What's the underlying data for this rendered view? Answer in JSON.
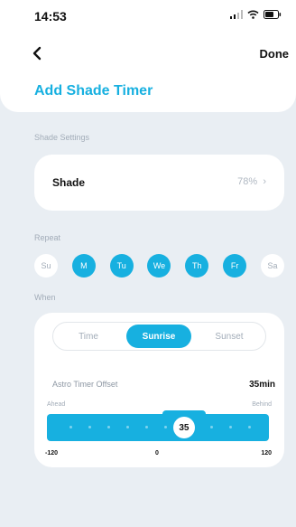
{
  "status": {
    "time": "14:53"
  },
  "nav": {
    "done_label": "Done"
  },
  "page": {
    "title": "Add Shade Timer"
  },
  "shade_settings": {
    "section_label": "Shade Settings",
    "shade_label": "Shade",
    "shade_value": "78%"
  },
  "repeat": {
    "section_label": "Repeat",
    "days": [
      {
        "label": "Su",
        "selected": false
      },
      {
        "label": "M",
        "selected": true
      },
      {
        "label": "Tu",
        "selected": true
      },
      {
        "label": "We",
        "selected": true
      },
      {
        "label": "Th",
        "selected": true
      },
      {
        "label": "Fr",
        "selected": true
      },
      {
        "label": "Sa",
        "selected": false
      }
    ]
  },
  "when": {
    "section_label": "When",
    "modes": [
      {
        "label": "Time",
        "selected": false
      },
      {
        "label": "Sunrise",
        "selected": true
      },
      {
        "label": "Sunset",
        "selected": false
      }
    ],
    "offset_label": "Astro Timer Offset",
    "offset_value": "35min",
    "ahead_label": "Ahead",
    "behind_label": "Behind",
    "slider": {
      "min": -120,
      "max": 120,
      "value": 35,
      "thumb_label": "35"
    },
    "axis_labels": [
      "-120",
      "0",
      "120"
    ]
  },
  "colors": {
    "accent": "#17b0e0",
    "background": "#e9eef3",
    "muted_text": "#a2acb8"
  }
}
